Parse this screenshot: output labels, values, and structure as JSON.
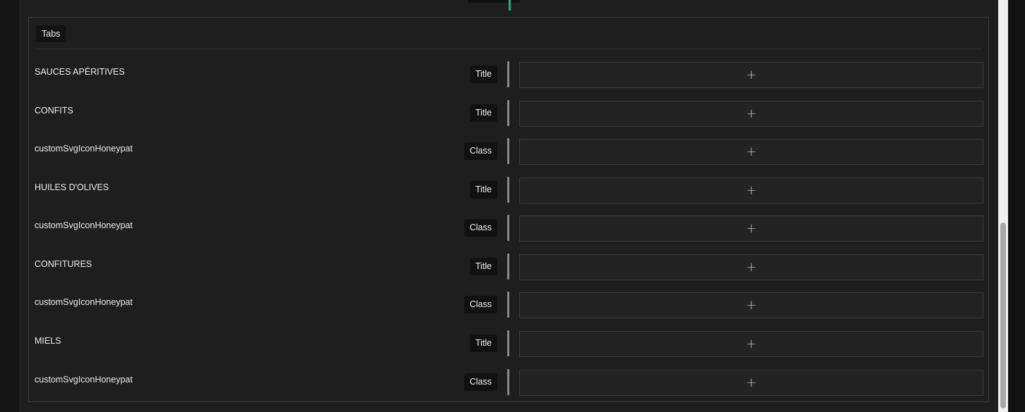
{
  "group": {
    "title": "Tabs"
  },
  "rows": [
    {
      "label": "SAUCES APÉRITIVES",
      "tag": "Title",
      "add_icon": "plus-icon"
    },
    {
      "label": "CONFITS",
      "tag": "Title",
      "add_icon": "plus-icon"
    },
    {
      "label": "customSvgIconHoneypat",
      "tag": "Class",
      "add_icon": "plus-icon"
    },
    {
      "label": "HUILES D'OLIVES",
      "tag": "Title",
      "add_icon": "plus-icon"
    },
    {
      "label": "customSvgIconHoneypat",
      "tag": "Class",
      "add_icon": "plus-icon"
    },
    {
      "label": "CONFITURES",
      "tag": "Title",
      "add_icon": "plus-icon"
    },
    {
      "label": "customSvgIconHoneypat",
      "tag": "Class",
      "add_icon": "plus-icon"
    },
    {
      "label": "MIELS",
      "tag": "Title",
      "add_icon": "plus-icon"
    },
    {
      "label": "customSvgIconHoneypat",
      "tag": "Class",
      "add_icon": "plus-icon"
    }
  ],
  "colors": {
    "background": "#1e1e1e",
    "tag_background": "#111111",
    "accent": "#1fae8f",
    "divider": "#8a8a8a"
  }
}
